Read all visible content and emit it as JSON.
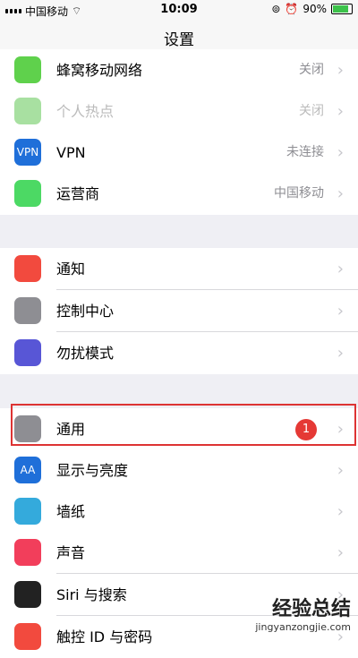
{
  "status": {
    "carrier": "中国移动",
    "time": "10:09",
    "battery": "90%"
  },
  "nav": {
    "title": "设置"
  },
  "rows": [
    {
      "label": "蜂窝移动网络",
      "value": "关闭",
      "icon": "antenna-icon",
      "color": "#5fd14c"
    },
    {
      "label": "个人热点",
      "value": "关闭",
      "icon": "hotspot-icon",
      "color": "#a8e0a1"
    },
    {
      "label": "VPN",
      "value": "未连接",
      "icon": "vpn-icon",
      "icon_text": "VPN",
      "color": "#1f6fd9"
    },
    {
      "label": "运营商",
      "value": "中国移动",
      "icon": "phone-icon",
      "color": "#4cd964"
    },
    {
      "label": "通知",
      "value": "",
      "icon": "notification-icon",
      "color": "#f24a3e"
    },
    {
      "label": "控制中心",
      "value": "",
      "icon": "control-center-icon",
      "color": "#8e8e93"
    },
    {
      "label": "勿扰模式",
      "value": "",
      "icon": "moon-icon",
      "color": "#5856d6"
    },
    {
      "label": "通用",
      "value": "",
      "icon": "gear-icon",
      "color": "#8e8e93",
      "badge": "1"
    },
    {
      "label": "显示与亮度",
      "value": "",
      "icon": "display-icon",
      "icon_text": "AA",
      "color": "#1f6fd9"
    },
    {
      "label": "墙纸",
      "value": "",
      "icon": "wallpaper-icon",
      "color": "#34aadc"
    },
    {
      "label": "声音",
      "value": "",
      "icon": "sound-icon",
      "color": "#f23e5b"
    },
    {
      "label": "Siri 与搜索",
      "value": "",
      "icon": "siri-icon",
      "color": "#222"
    },
    {
      "label": "触控 ID 与密码",
      "value": "",
      "icon": "touchid-icon",
      "color": "#f24a3e"
    }
  ],
  "watermark": {
    "title": "经验总结",
    "url": "jingyanzongjie.com"
  }
}
